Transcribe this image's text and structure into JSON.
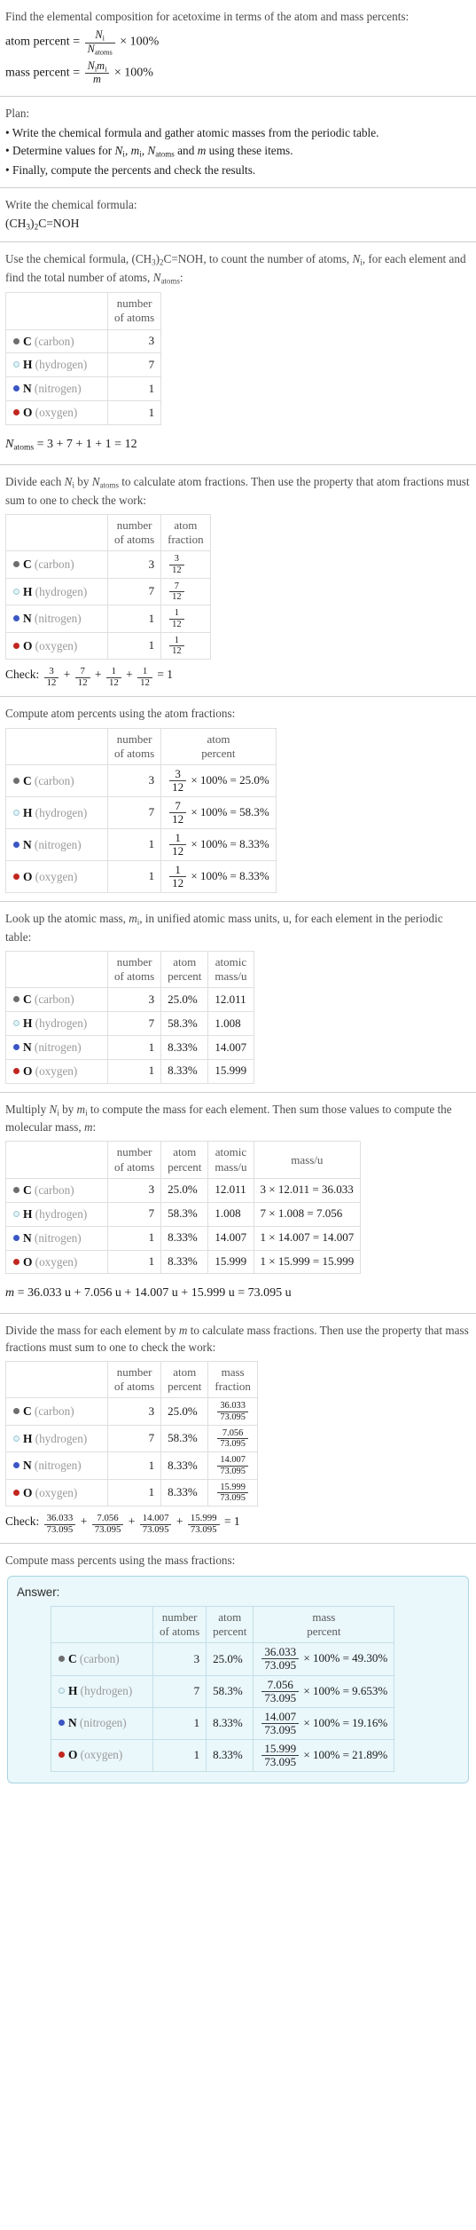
{
  "colors": {
    "carbon": "#6e6e6e",
    "hydrogen": "#e3f3f7",
    "hydrogen_border": "#9ec8d4",
    "nitrogen": "#3b56c4",
    "oxygen": "#c0271f",
    "answer_bg": "#eaf7fb",
    "answer_border": "#a8d4e0"
  },
  "intro": {
    "line1": "Find the elemental composition for acetoxime in terms of the atom and mass percents:",
    "atom_percent_label": "atom percent",
    "mass_percent_label": "mass percent",
    "equals": "=",
    "times100": "× 100%",
    "atom_percent_num": "N",
    "atom_percent_num_sub": "i",
    "atom_percent_den": "N",
    "atom_percent_den_sub": "atoms",
    "mass_percent_num": "N",
    "mass_percent_num_sub": "i",
    "mass_percent_num2": "m",
    "mass_percent_num2_sub": "i",
    "mass_percent_den": "m"
  },
  "plan": {
    "label": "Plan:",
    "items": [
      "Write the chemical formula and gather atomic masses from the periodic table.",
      "Determine values for N<sub>i</sub>, m<sub>i</sub>, N<sub>atoms</sub> and m using these items.",
      "Finally, compute the percents and check the results."
    ]
  },
  "formula_section": {
    "prompt": "Write the chemical formula:",
    "formula": "(CH3)2C=NOH"
  },
  "count_section": {
    "prompt_a": "Use the chemical formula, (CH",
    "prompt_b": ", to count the number of atoms, ",
    "prompt_c": ", for each element and find the total number of atoms, ",
    "prompt_full": "Use the chemical formula, (CH3)2C=NOH, to count the number of atoms, Ni, for each element and find the total number of atoms, Natoms:",
    "header_number_of_atoms": [
      "number",
      "of atoms"
    ],
    "total_line": "Natoms = 3 + 7 + 1 + 1 = 12",
    "total_sum": "3 + 7 + 1 + 1 = 12"
  },
  "elements": [
    {
      "symbol": "C",
      "name": "(carbon)",
      "color_key": "carbon",
      "atoms": "3",
      "atom_fraction_num": "3",
      "atom_fraction_den": "12",
      "atom_percent": "25.0%",
      "atomic_mass": "12.011",
      "mass_expr": "3 × 12.011 = 36.033",
      "mass_value": "36.033",
      "mass_percent": "49.30%"
    },
    {
      "symbol": "H",
      "name": "(hydrogen)",
      "color_key": "hydrogen",
      "atoms": "7",
      "atom_fraction_num": "7",
      "atom_fraction_den": "12",
      "atom_percent": "58.3%",
      "atomic_mass": "1.008",
      "mass_expr": "7 × 1.008 = 7.056",
      "mass_value": "7.056",
      "mass_percent": "9.653%"
    },
    {
      "symbol": "N",
      "name": "(nitrogen)",
      "color_key": "nitrogen",
      "atoms": "1",
      "atom_fraction_num": "1",
      "atom_fraction_den": "12",
      "atom_percent": "8.33%",
      "atomic_mass": "14.007",
      "mass_expr": "1 × 14.007 = 14.007",
      "mass_value": "14.007",
      "mass_percent": "19.16%"
    },
    {
      "symbol": "O",
      "name": "(oxygen)",
      "color_key": "oxygen",
      "atoms": "1",
      "atom_fraction_num": "1",
      "atom_fraction_den": "12",
      "atom_percent": "8.33%",
      "atomic_mass": "15.999",
      "mass_expr": "1 × 15.999 = 15.999",
      "mass_value": "15.999",
      "mass_percent": "21.89%"
    }
  ],
  "atom_fraction_section": {
    "prompt": "Divide each Ni by Natoms to calculate atom fractions. Then use the property that atom fractions must sum to one to check the work:",
    "header_atom_fraction": [
      "atom",
      "fraction"
    ],
    "check_label": "Check:",
    "check_result": "= 1"
  },
  "atom_percent_section": {
    "prompt": "Compute atom percents using the atom fractions:",
    "header_atom_percent": [
      "atom",
      "percent"
    ],
    "times100": "× 100% ="
  },
  "atomic_mass_section": {
    "prompt": "Look up the atomic mass, mi, in unified atomic mass units, u, for each element in the periodic table:",
    "header_atomic_mass": [
      "atomic",
      "mass/u"
    ]
  },
  "mass_section": {
    "prompt": "Multiply Ni by mi to compute the mass for each element. Then sum those values to compute the molecular mass, m:",
    "header_mass": "mass/u",
    "molecular_mass_line": "m = 36.033 u + 7.056 u + 14.007 u + 15.999 u = 73.095 u",
    "molecular_mass_rhs": "= 36.033 u + 7.056 u + 14.007 u + 15.999 u = 73.095 u",
    "total_mass": "73.095"
  },
  "mass_fraction_section": {
    "prompt": "Divide the mass for each element by m to calculate mass fractions. Then use the property that mass fractions must sum to one to check the work:",
    "header_mass_fraction": [
      "mass",
      "fraction"
    ],
    "check_label": "Check:",
    "check_result": "= 1"
  },
  "mass_percent_section": {
    "prompt": "Compute mass percents using the mass fractions:",
    "answer_label": "Answer:",
    "header_mass_percent": [
      "mass",
      "percent"
    ],
    "times100": "× 100% ="
  },
  "symbols": {
    "plus": "+",
    "times": "×",
    "equals": "=",
    "one": "1"
  }
}
